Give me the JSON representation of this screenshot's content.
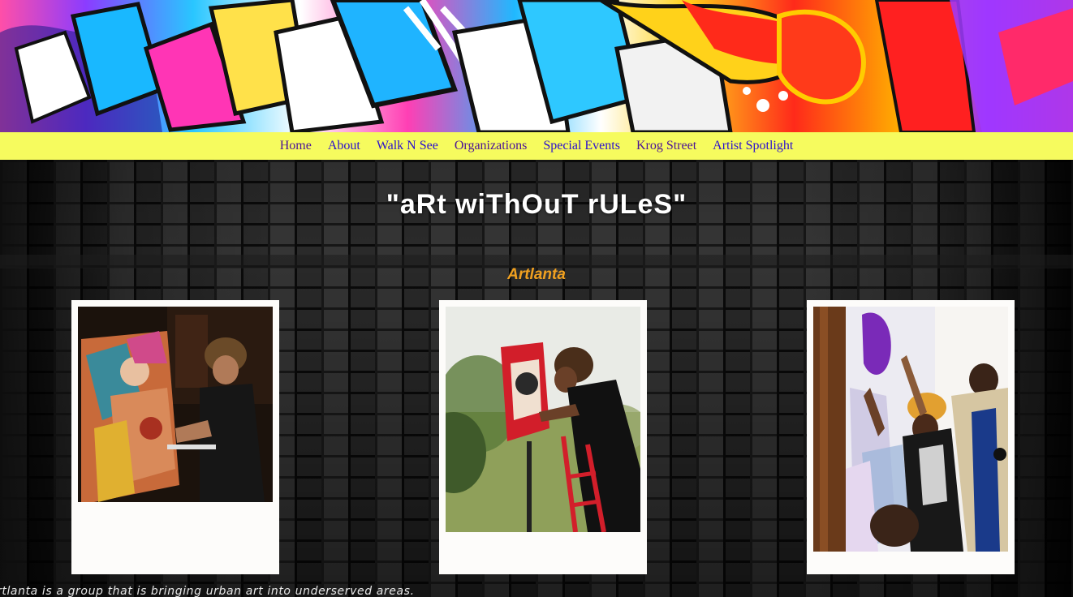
{
  "nav": {
    "items": [
      {
        "label": "Home"
      },
      {
        "label": "About"
      },
      {
        "label": "Walk N See"
      },
      {
        "label": "Organizations"
      },
      {
        "label": "Special Events"
      },
      {
        "label": "Krog Street"
      },
      {
        "label": "Artist Spotlight"
      }
    ]
  },
  "main": {
    "title": "\"aRt wiThOuT rULeS\"",
    "subtitle": "Artlanta",
    "description": "rtlanta is a group that is bringing urban art into underserved areas."
  },
  "colors": {
    "nav_bg": "#f6fb5e",
    "nav_link": "#2b0fcf",
    "nav_link_visited": "#4b1296",
    "subtitle": "#f0a020",
    "card_bg": "#fdfcfa"
  },
  "icons": {
    "banner": "graffiti-banner-image",
    "photos": [
      "artist-painting-canvas-photo",
      "artist-painting-sign-photo",
      "group-painting-mural-photo"
    ]
  }
}
